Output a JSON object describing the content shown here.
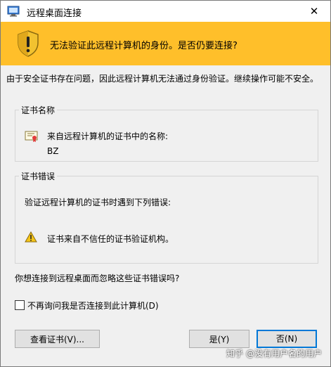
{
  "window": {
    "title": "远程桌面连接",
    "close_glyph": "✕"
  },
  "banner": {
    "text": "无法验证此远程计算机的身份。是否仍要连接?",
    "background": "#ffbf2a"
  },
  "description": "由于安全证书存在问题，因此远程计算机无法通过身份验证。继续操作可能不安全。",
  "cert_name_group": {
    "legend": "证书名称",
    "label": "来自远程计算机的证书中的名称:",
    "value": "BZ"
  },
  "cert_error_group": {
    "legend": "证书错误",
    "description": "验证远程计算机的证书时遇到下列错误:",
    "errors": [
      {
        "icon": "warning-icon",
        "text": "证书来自不信任的证书验证机构。"
      }
    ]
  },
  "question": "你想连接到远程桌面而忽略这些证书错误吗?",
  "checkbox": {
    "label": "不再询问我是否连接到此计算机(D)",
    "checked": false
  },
  "buttons": {
    "view_cert": "查看证书(V)...",
    "yes": "是(Y)",
    "no": "否(N)"
  },
  "watermark": "知乎 @没有用户名的用户",
  "colors": {
    "accent": "#0078d7",
    "dialog_bg": "#f0f0f0"
  }
}
